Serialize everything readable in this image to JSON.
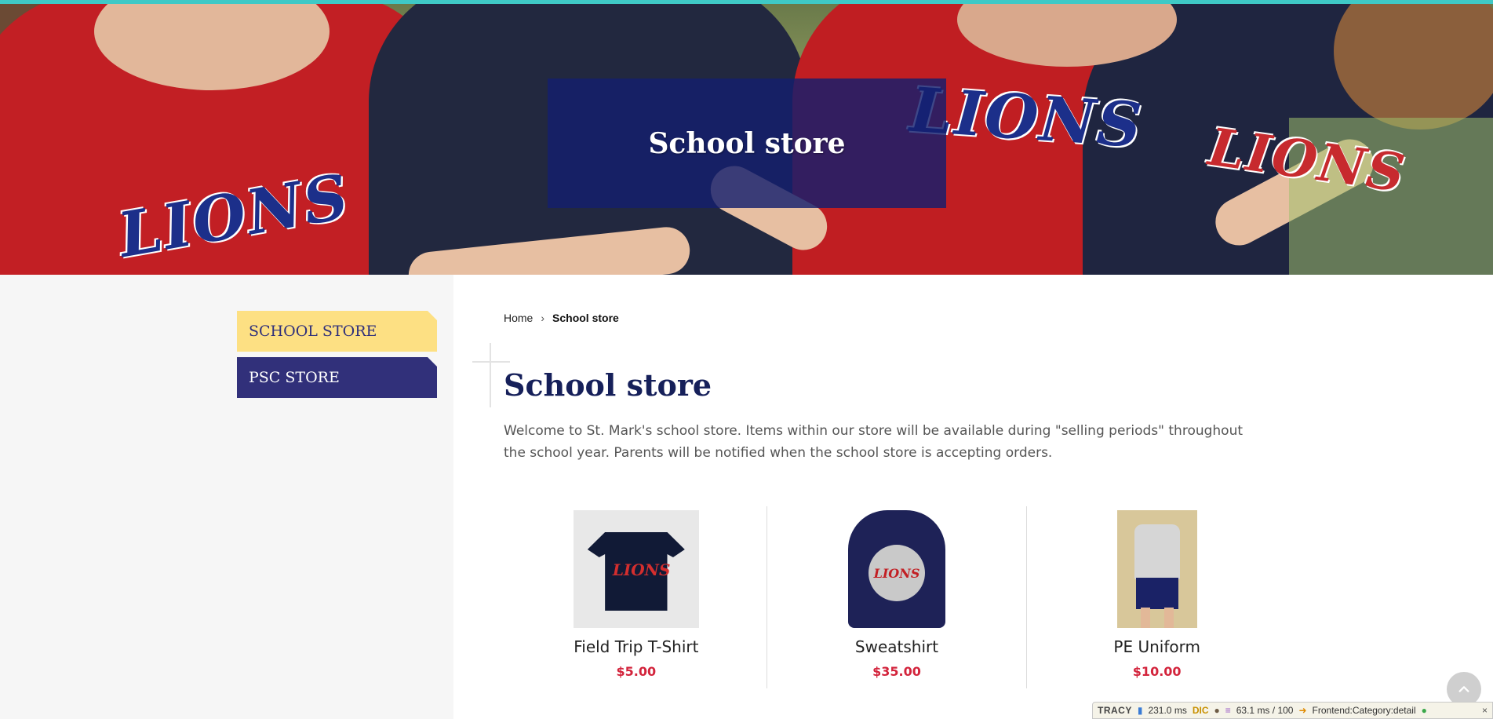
{
  "hero": {
    "title": "School store",
    "image_alt": "Students wearing St. Mark's Lions t-shirts",
    "logo_text": "LIONS"
  },
  "sidebar": {
    "items": [
      {
        "label": "SCHOOL STORE",
        "active": true
      },
      {
        "label": "PSC STORE",
        "active": false
      }
    ]
  },
  "breadcrumb": {
    "home": "Home",
    "separator": "›",
    "current": "School store"
  },
  "main": {
    "title": "School store",
    "intro": "Welcome to St. Mark's school store. Items within our store will be available during \"selling periods\" throughout the school year. Parents will be notified when the school store is accepting orders."
  },
  "products": [
    {
      "name": "Field Trip T-Shirt",
      "price": "$5.00",
      "image": "navy-tshirt",
      "emblem": "LIONS"
    },
    {
      "name": "Sweatshirt",
      "price": "$35.00",
      "image": "navy-hoodie",
      "emblem": "LIONS"
    },
    {
      "name": "PE Uniform",
      "price": "$10.00",
      "image": "pe-uniform",
      "emblem": ""
    }
  ],
  "tracy_bar": {
    "brand": "TRACY",
    "time": "231.0 ms",
    "dic": "DIC",
    "db": "63.1 ms / 100",
    "route": "Frontend:Category:detail",
    "close": "×"
  },
  "colors": {
    "accent_teal": "#3fc9c6",
    "navy": "#16205a",
    "sidebar_active": "#fde083",
    "sidebar_inactive": "#31307a",
    "price_red": "#d3243c"
  },
  "icons": {
    "scroll_top": "chevron-up-icon",
    "breadcrumb_sep": "chevron-right-icon"
  }
}
